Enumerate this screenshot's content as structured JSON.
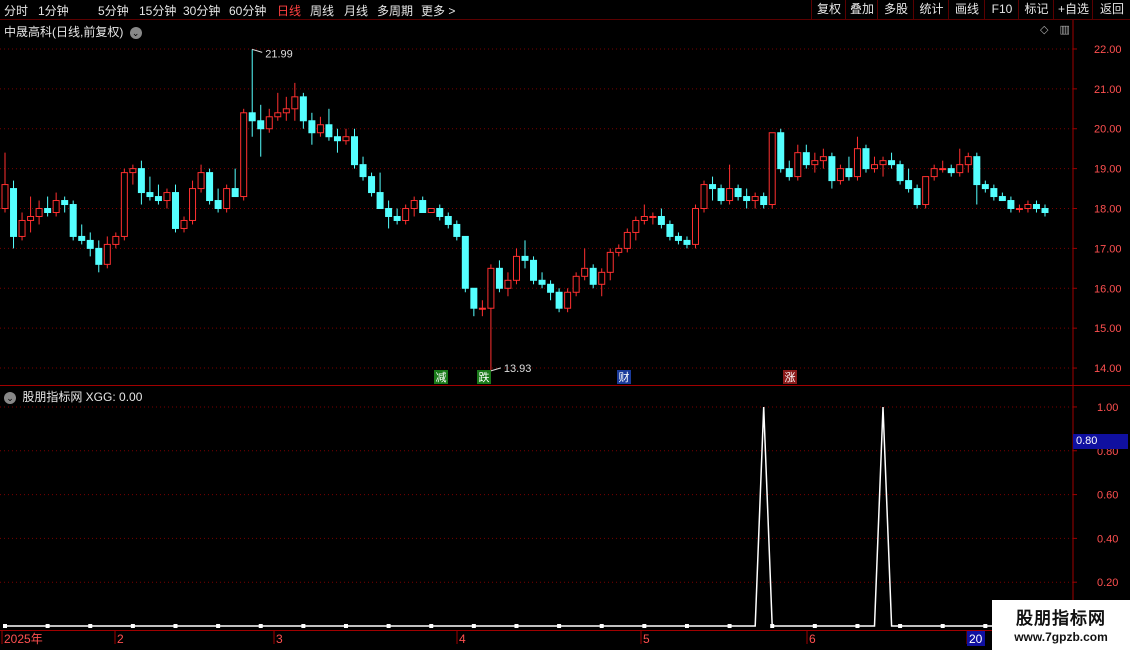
{
  "toolbar": {
    "periods": [
      "分时",
      "1分钟",
      "5分钟",
      "15分钟",
      "30分钟",
      "60分钟",
      "日线",
      "周线",
      "月线",
      "多周期",
      "更多 >"
    ],
    "active_period": "日线",
    "buttons": [
      "复权",
      "叠加",
      "多股",
      "统计",
      "画线",
      "F10",
      "标记",
      "+自选",
      "返回"
    ]
  },
  "main": {
    "title": "中晟高科(日线,前复权)",
    "price_labels": [
      "22.00",
      "21.00",
      "20.00",
      "19.00",
      "18.00",
      "17.00",
      "16.00",
      "15.00",
      "14.00"
    ],
    "high_annotation": "21.99",
    "low_annotation": "13.93",
    "event_markers": [
      {
        "text": "减",
        "color": "#1a7a1a"
      },
      {
        "text": "跌",
        "color": "#1a7a1a"
      },
      {
        "text": "财",
        "color": "#1a3a9a"
      },
      {
        "text": "涨",
        "color": "#8a1a1a"
      }
    ]
  },
  "indicator": {
    "title": "股朋指标网 XGG: 0.00",
    "value_labels": [
      "1.00",
      "0.80",
      "0.60",
      "0.40",
      "0.20"
    ],
    "current_value": "0.80"
  },
  "date_axis": [
    "2025年",
    "2",
    "3",
    "4",
    "5",
    "6",
    "20"
  ],
  "watermark": {
    "line1": "股朋指标网",
    "line2": "www.7gpzb.com"
  },
  "colors": {
    "up": "#ff3030",
    "down": "#54ffff",
    "grid": "#7a0000",
    "axis": "#a00000"
  },
  "chart_data": {
    "type": "candlestick",
    "ylim": [
      13.6,
      22.2
    ],
    "ohlc": [
      [
        18.0,
        19.4,
        17.9,
        18.6
      ],
      [
        18.5,
        18.7,
        17.0,
        17.3
      ],
      [
        17.3,
        17.9,
        17.2,
        17.7
      ],
      [
        17.7,
        18.3,
        17.4,
        17.8
      ],
      [
        17.8,
        18.2,
        17.6,
        18.0
      ],
      [
        18.0,
        18.3,
        17.8,
        17.9
      ],
      [
        17.9,
        18.4,
        17.8,
        18.2
      ],
      [
        18.2,
        18.3,
        17.9,
        18.1
      ],
      [
        18.1,
        18.2,
        17.2,
        17.3
      ],
      [
        17.3,
        17.6,
        17.1,
        17.2
      ],
      [
        17.2,
        17.4,
        16.8,
        17.0
      ],
      [
        17.0,
        17.2,
        16.4,
        16.6
      ],
      [
        16.6,
        17.3,
        16.5,
        17.1
      ],
      [
        17.1,
        17.4,
        17.0,
        17.3
      ],
      [
        17.3,
        19.0,
        17.2,
        18.9
      ],
      [
        18.9,
        19.1,
        18.6,
        19.0
      ],
      [
        19.0,
        19.2,
        18.1,
        18.4
      ],
      [
        18.4,
        18.8,
        18.2,
        18.3
      ],
      [
        18.3,
        18.6,
        18.1,
        18.2
      ],
      [
        18.2,
        18.5,
        18.0,
        18.4
      ],
      [
        18.4,
        18.6,
        17.4,
        17.5
      ],
      [
        17.5,
        17.8,
        17.4,
        17.7
      ],
      [
        17.7,
        18.7,
        17.6,
        18.5
      ],
      [
        18.5,
        19.1,
        18.4,
        18.9
      ],
      [
        18.9,
        19.0,
        18.1,
        18.2
      ],
      [
        18.2,
        18.5,
        17.9,
        18.0
      ],
      [
        18.0,
        18.6,
        17.9,
        18.5
      ],
      [
        18.5,
        19.0,
        18.3,
        18.3
      ],
      [
        18.3,
        20.5,
        18.2,
        20.4
      ],
      [
        20.4,
        21.99,
        19.8,
        20.2
      ],
      [
        20.2,
        20.6,
        19.3,
        20.0
      ],
      [
        20.0,
        20.5,
        19.9,
        20.3
      ],
      [
        20.3,
        20.9,
        20.2,
        20.4
      ],
      [
        20.4,
        20.8,
        20.2,
        20.5
      ],
      [
        20.5,
        21.15,
        20.2,
        20.8
      ],
      [
        20.8,
        20.9,
        20.0,
        20.2
      ],
      [
        20.2,
        20.4,
        19.6,
        19.9
      ],
      [
        19.9,
        20.3,
        19.8,
        20.1
      ],
      [
        20.1,
        20.5,
        19.7,
        19.8
      ],
      [
        19.8,
        20.0,
        19.4,
        19.7
      ],
      [
        19.7,
        20.0,
        19.6,
        19.8
      ],
      [
        19.8,
        20.0,
        19.0,
        19.1
      ],
      [
        19.1,
        19.3,
        18.7,
        18.8
      ],
      [
        18.8,
        18.9,
        18.3,
        18.4
      ],
      [
        18.4,
        18.9,
        18.0,
        18.0
      ],
      [
        18.0,
        18.2,
        17.5,
        17.8
      ],
      [
        17.8,
        18.0,
        17.6,
        17.7
      ],
      [
        17.7,
        18.1,
        17.6,
        18.0
      ],
      [
        18.0,
        18.3,
        17.8,
        18.2
      ],
      [
        18.2,
        18.3,
        17.9,
        17.9
      ],
      [
        17.9,
        18.0,
        17.9,
        18.0
      ],
      [
        18.0,
        18.1,
        17.7,
        17.8
      ],
      [
        17.8,
        17.9,
        17.5,
        17.6
      ],
      [
        17.6,
        17.7,
        17.2,
        17.3
      ],
      [
        17.3,
        16.7,
        15.9,
        16.0
      ],
      [
        16.0,
        16.0,
        15.3,
        15.5
      ],
      [
        15.5,
        15.7,
        15.3,
        15.5
      ],
      [
        15.5,
        16.6,
        13.93,
        16.5
      ],
      [
        16.5,
        16.7,
        15.9,
        16.0
      ],
      [
        16.0,
        16.4,
        15.8,
        16.2
      ],
      [
        16.2,
        17.0,
        16.1,
        16.8
      ],
      [
        16.8,
        17.2,
        16.5,
        16.7
      ],
      [
        16.7,
        16.8,
        16.1,
        16.2
      ],
      [
        16.2,
        16.4,
        16.0,
        16.1
      ],
      [
        16.1,
        16.2,
        15.7,
        15.9
      ],
      [
        15.9,
        16.0,
        15.4,
        15.5
      ],
      [
        15.5,
        16.0,
        15.4,
        15.9
      ],
      [
        15.9,
        16.4,
        15.8,
        16.3
      ],
      [
        16.3,
        17.0,
        16.2,
        16.5
      ],
      [
        16.5,
        16.6,
        16.0,
        16.1
      ],
      [
        16.1,
        16.5,
        15.8,
        16.4
      ],
      [
        16.4,
        17.0,
        16.2,
        16.9
      ],
      [
        16.9,
        17.1,
        16.8,
        17.0
      ],
      [
        17.0,
        17.5,
        16.9,
        17.4
      ],
      [
        17.4,
        17.8,
        17.2,
        17.7
      ],
      [
        17.7,
        18.1,
        17.6,
        17.8
      ],
      [
        17.8,
        17.9,
        17.6,
        17.8
      ],
      [
        17.8,
        18.0,
        17.5,
        17.6
      ],
      [
        17.6,
        17.7,
        17.2,
        17.3
      ],
      [
        17.3,
        17.4,
        17.1,
        17.2
      ],
      [
        17.2,
        17.3,
        17.0,
        17.1
      ],
      [
        17.1,
        18.1,
        17.0,
        18.0
      ],
      [
        18.0,
        18.7,
        17.9,
        18.6
      ],
      [
        18.6,
        18.8,
        18.2,
        18.5
      ],
      [
        18.5,
        18.6,
        18.1,
        18.2
      ],
      [
        18.2,
        19.1,
        18.1,
        18.5
      ],
      [
        18.5,
        18.6,
        18.2,
        18.3
      ],
      [
        18.3,
        18.5,
        18.0,
        18.2
      ],
      [
        18.2,
        18.4,
        18.0,
        18.3
      ],
      [
        18.3,
        18.4,
        18.0,
        18.1
      ],
      [
        18.1,
        19.9,
        18.0,
        19.9
      ],
      [
        19.9,
        20.0,
        18.9,
        19.0
      ],
      [
        19.0,
        19.2,
        18.7,
        18.8
      ],
      [
        18.8,
        19.6,
        18.7,
        19.4
      ],
      [
        19.4,
        19.6,
        19.0,
        19.1
      ],
      [
        19.1,
        19.4,
        18.9,
        19.2
      ],
      [
        19.2,
        19.5,
        19.0,
        19.3
      ],
      [
        19.3,
        19.4,
        18.5,
        18.7
      ],
      [
        18.7,
        19.1,
        18.6,
        19.0
      ],
      [
        19.0,
        19.3,
        18.7,
        18.8
      ],
      [
        18.8,
        19.8,
        18.7,
        19.5
      ],
      [
        19.5,
        19.6,
        18.9,
        19.0
      ],
      [
        19.0,
        19.3,
        18.9,
        19.1
      ],
      [
        19.1,
        19.3,
        18.8,
        19.2
      ],
      [
        19.2,
        19.4,
        19.0,
        19.1
      ],
      [
        19.1,
        19.2,
        18.6,
        18.7
      ],
      [
        18.7,
        19.0,
        18.4,
        18.5
      ],
      [
        18.5,
        18.6,
        18.0,
        18.1
      ],
      [
        18.1,
        18.8,
        18.0,
        18.8
      ],
      [
        18.8,
        19.1,
        18.7,
        19.0
      ],
      [
        19.0,
        19.2,
        18.9,
        19.0
      ],
      [
        19.0,
        19.1,
        18.8,
        18.9
      ],
      [
        18.9,
        19.5,
        18.8,
        19.1
      ],
      [
        19.1,
        19.4,
        18.9,
        19.3
      ],
      [
        19.3,
        19.4,
        18.1,
        18.6
      ],
      [
        18.6,
        18.7,
        18.4,
        18.5
      ],
      [
        18.5,
        18.6,
        18.2,
        18.3
      ],
      [
        18.3,
        18.4,
        18.2,
        18.2
      ],
      [
        18.2,
        18.3,
        17.9,
        18.0
      ],
      [
        18.0,
        18.1,
        17.9,
        18.0
      ],
      [
        18.0,
        18.2,
        17.9,
        18.1
      ],
      [
        18.1,
        18.2,
        17.9,
        18.0
      ],
      [
        18.0,
        18.1,
        17.8,
        17.9
      ]
    ],
    "indicator_series": {
      "name": "XGG",
      "ylim": [
        0,
        1.05
      ],
      "spikes_at": [
        89,
        103
      ],
      "spike_value": 1.0,
      "base_value": 0.0
    }
  }
}
